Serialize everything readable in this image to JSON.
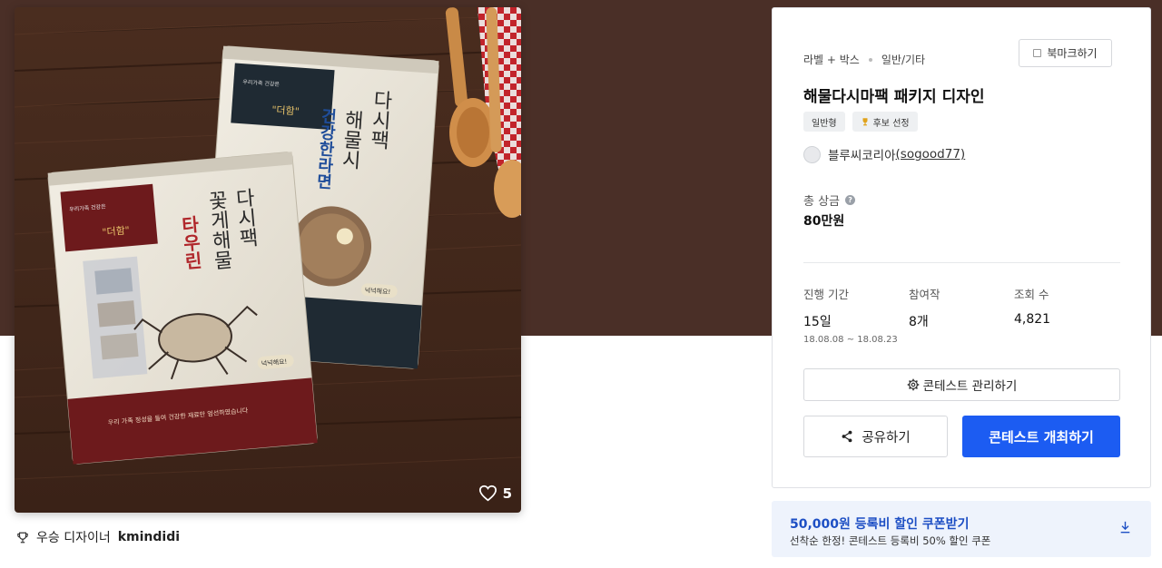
{
  "hero": {
    "like_count": "5",
    "packages": {
      "front": {
        "tag_small": "우리가족 건강은",
        "tag_brand": "\"더함\"",
        "red_title": "타우린",
        "title_col1": "꽃게해물",
        "title_col2": "다시팩",
        "badge": "넉넉해요!",
        "slogan": "우리 가족 정성을 들여 건강한 재료만 엄선하였습니다"
      },
      "back": {
        "tag_small": "우리가족 건강은",
        "tag_brand": "\"더함\"",
        "blue_title": "건강한라면",
        "title_col1": "해물시",
        "title_col2": "다시팩",
        "badge": "넉넉해요!"
      }
    }
  },
  "winner": {
    "label": "우승 디자이너",
    "name": "kmindidi"
  },
  "panel": {
    "category": "라벨 + 박스",
    "subcategory": "일반/기타",
    "bookmark_label": "북마크하기",
    "title": "해물다시마팩 패키지 디자인",
    "tags": [
      "일반형",
      "후보 선정"
    ],
    "owner_name": "블루씨코리아",
    "owner_handle": "(sogood77)",
    "prize_label": "총 상금",
    "prize_value": "80만원",
    "stats": {
      "period_label": "진행 기간",
      "period_value": "15일",
      "period_range": "18.08.08  ~  18.08.23",
      "entries_label": "참여작",
      "entries_value": "8개",
      "views_label": "조회 수",
      "views_value": "4,821"
    },
    "manage_label": "콘테스트 관리하기",
    "share_label": "공유하기",
    "open_label": "콘테스트 개최하기"
  },
  "coupon": {
    "title": "50,000원 등록비 할인 쿠폰받기",
    "subtitle": "선착순 한정! 콘테스트 등록비 50% 할인 쿠폰"
  },
  "colors": {
    "top_band": "#4a2f27",
    "primary": "#1c5cf2",
    "coupon_bg": "#eef3fc",
    "coupon_text": "#1d4fc4"
  },
  "icons": [
    "heart-icon",
    "trophy-icon",
    "bookmark-icon",
    "question-icon",
    "gear-icon",
    "share-icon",
    "download-icon"
  ]
}
